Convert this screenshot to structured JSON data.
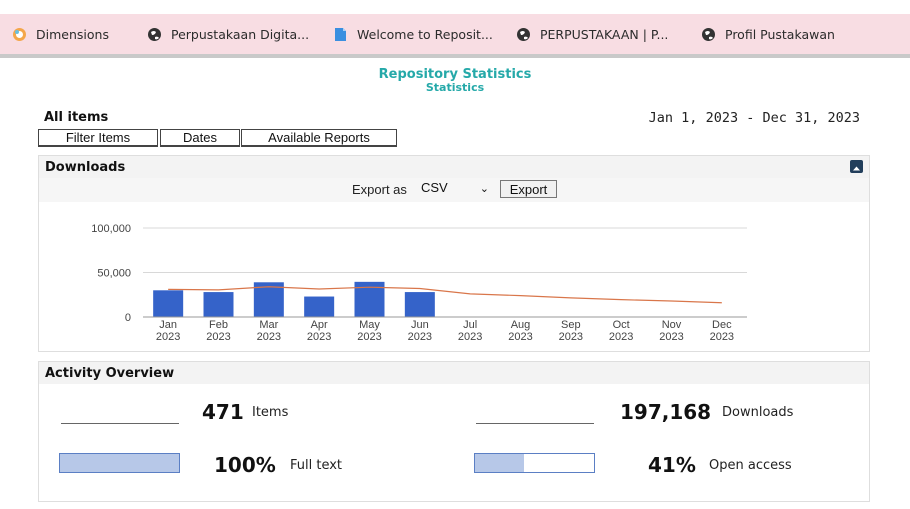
{
  "bookmarks": [
    {
      "label": "Dimensions",
      "icon": "dimensions-icon"
    },
    {
      "label": "Perpustakaan Digita...",
      "icon": "globe-icon"
    },
    {
      "label": "Welcome to Reposit...",
      "icon": "document-icon"
    },
    {
      "label": "PERPUSTAKAAN | P...",
      "icon": "globe-icon"
    },
    {
      "label": "Profil Pustakawan",
      "icon": "globe-icon"
    }
  ],
  "page": {
    "title": "Repository Statistics",
    "subtitle": "Statistics",
    "scope": "All items",
    "date_range": "Jan 1, 2023 - Dec 31, 2023"
  },
  "toolbar": {
    "filter_label": "Filter Items",
    "dates_label": "Dates",
    "reports_label": "Available Reports"
  },
  "downloads": {
    "heading": "Downloads",
    "export_label": "Export as",
    "export_format": "CSV",
    "export_button": "Export"
  },
  "chart_data": {
    "type": "bar",
    "categories": [
      "Jan 2023",
      "Feb 2023",
      "Mar 2023",
      "Apr 2023",
      "May 2023",
      "Jun 2023",
      "Jul 2023",
      "Aug 2023",
      "Sep 2023",
      "Oct 2023",
      "Nov 2023",
      "Dec 2023"
    ],
    "series": [
      {
        "type": "bar",
        "values": [
          30000,
          28000,
          39000,
          23000,
          39500,
          28000,
          0,
          0,
          0,
          0,
          0,
          0
        ],
        "color": "#3563c9"
      },
      {
        "type": "line",
        "values": [
          31000,
          30500,
          34000,
          31500,
          33500,
          32000,
          26000,
          24000,
          21500,
          19500,
          18000,
          16000
        ],
        "color": "#d9764a"
      }
    ],
    "y_ticks": [
      "0",
      "50,000",
      "100,000"
    ],
    "ylim": [
      0,
      100000
    ],
    "grid": true
  },
  "overview": {
    "heading": "Activity Overview",
    "items_value": "471",
    "items_label": "Items",
    "downloads_value": "197,168",
    "downloads_label": "Downloads",
    "fulltext_value": "100%",
    "fulltext_label": "Full text",
    "fulltext_fraction": 1.0,
    "openaccess_value": "41%",
    "openaccess_label": "Open access",
    "openaccess_fraction": 0.41
  },
  "colors": {
    "accent": "#25a9a9",
    "bar": "#3563c9",
    "trend": "#d9764a",
    "bookmark_bar": "#f8dde3"
  }
}
